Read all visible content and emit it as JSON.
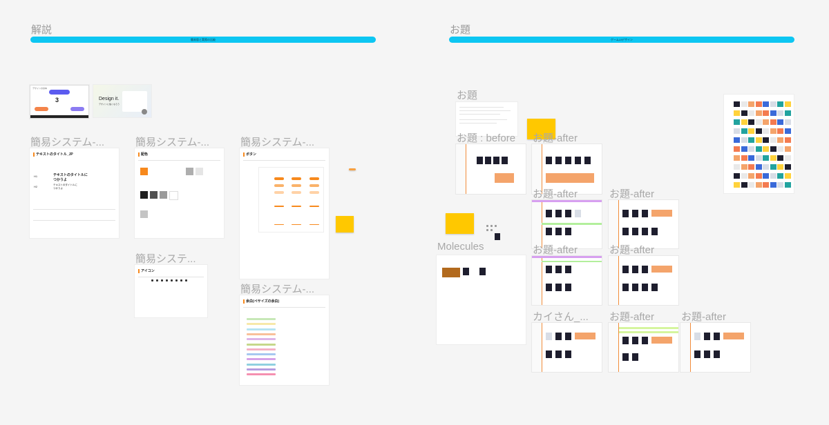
{
  "canvas": {
    "background": "#f5f5f5",
    "accent": "#0dc6f2",
    "highlight": "#f7891d",
    "sticky": "#ffc800"
  },
  "sections": {
    "left": {
      "title": "解説",
      "bar_text": "簡易版と実際の比較"
    },
    "right": {
      "title": "お題",
      "bar_text": "ゲームUIデザイン"
    }
  },
  "thumbs": {
    "slide1": {
      "heading": "3",
      "subtitle": "デザインの基本"
    },
    "slide2": {
      "heading": "Design it.",
      "subtitle": "デザインに強くなろう"
    }
  },
  "frames": {
    "typography": {
      "label": "簡易システム-...",
      "title": "テキストのタイトル_JP",
      "h1": "H1",
      "h2": "H2",
      "h1_sample": "テキストのタイトルに\nつかうよ",
      "h2_sample": "テキストのタイトルに\nつかうよ"
    },
    "color": {
      "label": "簡易システム-...",
      "title": "配色"
    },
    "button": {
      "label": "簡易システム-...",
      "title": "ボタン"
    },
    "icon": {
      "label": "簡易システ...",
      "title": "アイコン"
    },
    "spacing": {
      "label": "簡易システム-...",
      "title": "余白(ペサイズの余白)"
    },
    "odai_text": {
      "label": "お題"
    },
    "odai_before": {
      "label": "お題 : before"
    },
    "odai_after_1": {
      "label": "お題-after"
    },
    "odai_after_2": {
      "label": "お題-after"
    },
    "odai_after_3": {
      "label": "お題-after"
    },
    "odai_after_4": {
      "label": "お題-after"
    },
    "odai_after_5": {
      "label": "お題-after"
    },
    "kai": {
      "label": "カイさん_..."
    },
    "odai_after_6": {
      "label": "お題-after"
    },
    "odai_after_7": {
      "label": "お題-after"
    },
    "molecules": {
      "label": "Molecules"
    }
  },
  "spacing_stripes": [
    "#c7e8b7",
    "#f7e8a9",
    "#b5e4f2",
    "#f9c09a",
    "#ddb3e8",
    "#c5d88a",
    "#f4b0c4",
    "#a7c7f0",
    "#d6a0e8",
    "#8fd0e0",
    "#b49ce0",
    "#f590b0"
  ],
  "color_swatches": [
    "#f7891d",
    "#1e1e1e",
    "#505050",
    "#9a9a9a",
    "#ffffff",
    "#c4c4c4",
    "#aeaeae",
    "#e5e5e5"
  ]
}
